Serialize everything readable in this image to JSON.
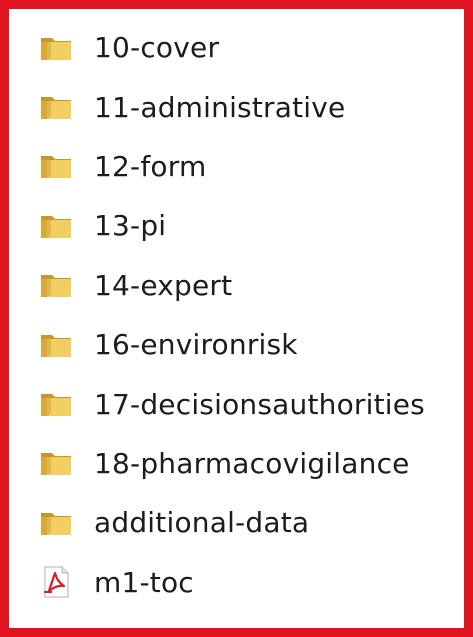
{
  "colors": {
    "frame_border": "#e0141e",
    "folder_front": "#f2cf63",
    "folder_back": "#d9a93a",
    "folder_tab": "#c8962d",
    "pdf_red": "#d61f26"
  },
  "files": [
    {
      "label": "10-cover",
      "icon": "folder-icon"
    },
    {
      "label": "11-administrative",
      "icon": "folder-icon"
    },
    {
      "label": "12-form",
      "icon": "folder-icon"
    },
    {
      "label": "13-pi",
      "icon": "folder-icon"
    },
    {
      "label": "14-expert",
      "icon": "folder-icon"
    },
    {
      "label": "16-environrisk",
      "icon": "folder-icon"
    },
    {
      "label": "17-decisionsauthorities",
      "icon": "folder-icon"
    },
    {
      "label": "18-pharmacovigilance",
      "icon": "folder-icon"
    },
    {
      "label": "additional-data",
      "icon": "folder-icon"
    },
    {
      "label": "m1-toc",
      "icon": "pdf-file-icon"
    }
  ]
}
